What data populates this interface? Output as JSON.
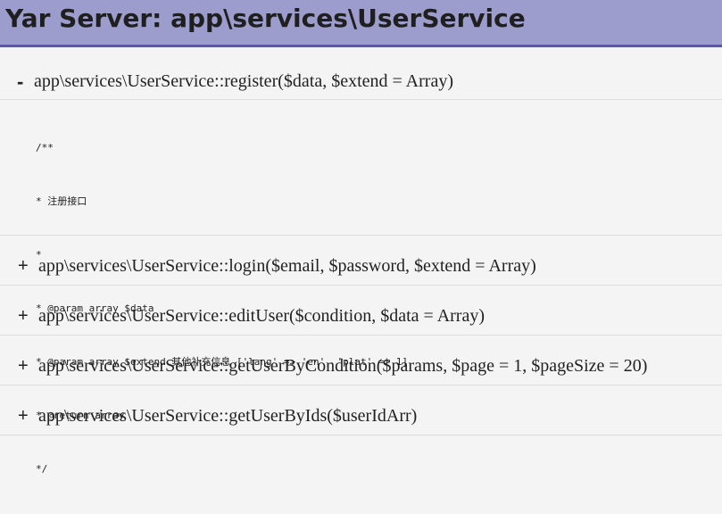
{
  "header": {
    "title": "Yar Server: app\\services\\UserService"
  },
  "methods": [
    {
      "toggle": "-",
      "signature": "app\\services\\UserService::register($data, $extend = Array)",
      "doc": [
        "/**",
        "* 注册接口",
        "*",
        "* @param array $data",
        "* @param array $extend 其他补充信息 ['lang' => 'en', 'plat' => 1]",
        "* @return array",
        "*/"
      ]
    },
    {
      "toggle": "+",
      "signature": "app\\services\\UserService::login($email, $password, $extend = Array)"
    },
    {
      "toggle": "+",
      "signature": "app\\services\\UserService::editUser($condition, $data = Array)"
    },
    {
      "toggle": "+",
      "signature": "app\\services\\UserService::getUserByCondition($params, $page = 1, $pageSize = 20)"
    },
    {
      "toggle": "+",
      "signature": "app\\services\\UserService::getUserByIds($userIdArr)"
    }
  ]
}
